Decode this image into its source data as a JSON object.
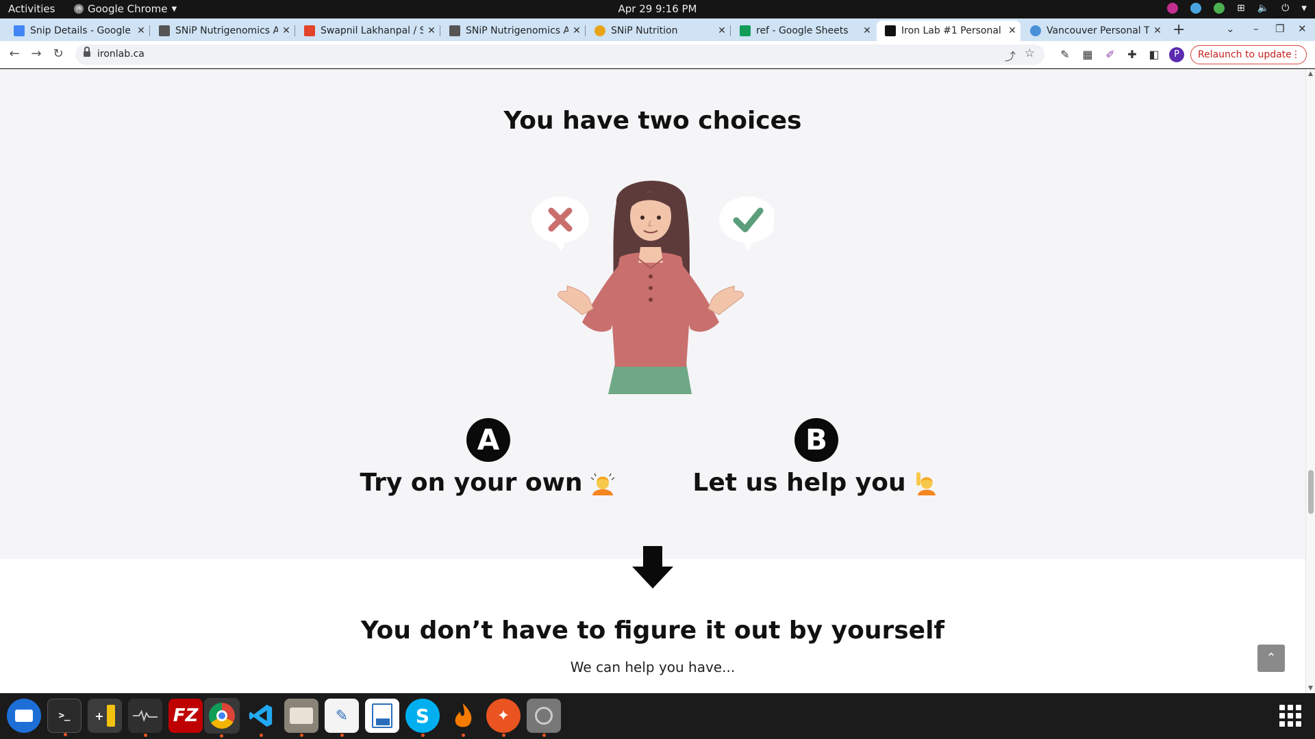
{
  "topbar": {
    "activities": "Activities",
    "app_name": "Google Chrome",
    "clock": "Apr 29  9:16 PM"
  },
  "tabs": [
    {
      "label": "Snip Details - Google",
      "favicon_color": "#4285f4",
      "icon": "docs-icon"
    },
    {
      "label": "SNiP Nutrigenomics A",
      "favicon_color": "#333333",
      "icon": "snip-icon"
    },
    {
      "label": "Swapnil Lakhanpal / S",
      "favicon_color": "#e24329",
      "icon": "gitlab-icon"
    },
    {
      "label": "SNiP Nutrigenomics A",
      "favicon_color": "#333333",
      "icon": "snip-icon"
    },
    {
      "label": "SNiP Nutrition",
      "favicon_color": "#e8a317",
      "icon": "snip-nutrition-icon"
    },
    {
      "label": "ref - Google Sheets",
      "favicon_color": "#0f9d58",
      "icon": "sheets-icon"
    },
    {
      "label": "Iron Lab #1 Personal",
      "favicon_color": "#111111",
      "icon": "ironlab-icon",
      "active": true
    },
    {
      "label": "Vancouver Personal T",
      "favicon_color": "#4a90d9",
      "icon": "vancouver-icon"
    }
  ],
  "omnibox": {
    "url": "ironlab.ca"
  },
  "toolbar": {
    "profile_initial": "P",
    "relaunch_label": "Relaunch to update"
  },
  "page": {
    "heading_choices": "You have two choices",
    "choice_a": {
      "badge": "A",
      "label": "Try on your own"
    },
    "choice_b": {
      "badge": "B",
      "label": "Let us help you"
    },
    "heading_figure": "You don’t have to figure it out by yourself",
    "subtext": "We can help you have..."
  },
  "colors": {
    "accent_relaunch": "#c5221f",
    "shirt": "#c9706e",
    "skirt": "#6fa886",
    "x_mark": "#c9706e",
    "check_mark": "#5a9e7a"
  },
  "dock": [
    {
      "name": "thunderbird",
      "color": "#1d6fd6",
      "glyph": "",
      "running": false
    },
    {
      "name": "terminal",
      "color": "#2b2b2b",
      "glyph": ">_",
      "running": true
    },
    {
      "name": "calculator",
      "color": "#444444",
      "glyph": "+−",
      "running": false
    },
    {
      "name": "system-monitor",
      "color": "#2f2f2f",
      "glyph": "~",
      "running": true
    },
    {
      "name": "filezilla",
      "color": "#bf0000",
      "glyph": "FZ",
      "running": false
    },
    {
      "name": "chrome",
      "color": "#ffffff",
      "glyph": "",
      "running": true,
      "active": true
    },
    {
      "name": "vscode",
      "color": "#1b1b1b",
      "glyph": "⟨⟩",
      "running": true
    },
    {
      "name": "files",
      "color": "#8a8378",
      "glyph": "",
      "running": true
    },
    {
      "name": "text-editor",
      "color": "#f4f4f4",
      "glyph": "✎",
      "running": true
    },
    {
      "name": "libreoffice-writer",
      "color": "#2a6ebb",
      "glyph": "≡",
      "running": false
    },
    {
      "name": "skype",
      "color": "#00aff0",
      "glyph": "S",
      "running": true
    },
    {
      "name": "ferdi",
      "color": "#f57b00",
      "glyph": "▲",
      "running": true
    },
    {
      "name": "inkscape-tool",
      "color": "#e95420",
      "glyph": "✦",
      "running": true
    },
    {
      "name": "disk-utility",
      "color": "#777777",
      "glyph": "◎",
      "running": true
    }
  ]
}
